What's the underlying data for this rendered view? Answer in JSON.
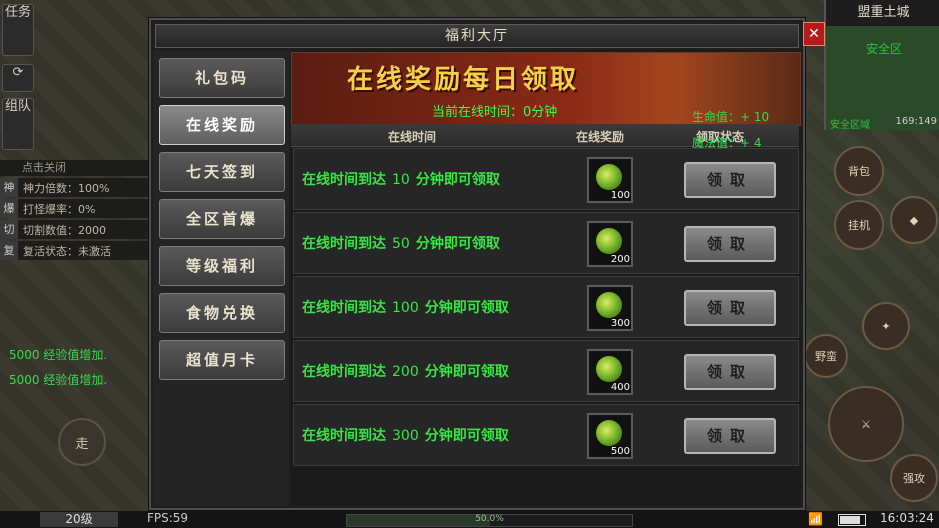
{
  "hud": {
    "left_buttons": [
      "任务",
      "组队"
    ],
    "stats_header": "点击关闭",
    "stats": [
      {
        "key": "神",
        "text": "神力倍数：100%"
      },
      {
        "key": "爆",
        "text": "打怪爆率：0%"
      },
      {
        "key": "切",
        "text": "切割数值：2000"
      },
      {
        "key": "复",
        "text": "复活状态：未激活"
      }
    ],
    "exp_messages": [
      "5000 经验值增加.",
      "5000 经验值增加."
    ],
    "walk_label": "走",
    "level": "20级",
    "fps": "FPS:59",
    "xp_percent": "50.0%",
    "clock": "16:03:24",
    "minimap_title": "盟重土城",
    "minimap_zone": "安全区",
    "minimap_safe": "安全区域",
    "minimap_coord": "169:149",
    "right_buttons": [
      "背包",
      "挂机",
      "野蛮",
      "强攻"
    ],
    "life": "生命值：+ 10",
    "mana": "魔法值：+ 4"
  },
  "dialog": {
    "title": "福利大厅",
    "close_label": "✕",
    "tabs": [
      {
        "label": "礼包码",
        "active": false
      },
      {
        "label": "在线奖励",
        "active": true
      },
      {
        "label": "七天签到",
        "active": false
      },
      {
        "label": "全区首爆",
        "active": false
      },
      {
        "label": "等级福利",
        "active": false
      },
      {
        "label": "食物兑换",
        "active": false
      },
      {
        "label": "超值月卡",
        "active": false
      }
    ],
    "banner_title": "在线奖励每日领取",
    "online_time": "当前在线时间：0分钟",
    "columns": {
      "time": "在线时间",
      "reward": "在线奖励",
      "status": "领取状态"
    },
    "rows": [
      {
        "prefix": "在线时间到达",
        "minutes": "10",
        "suffix": "分钟即可领取",
        "count": "100",
        "button": "领取"
      },
      {
        "prefix": "在线时间到达",
        "minutes": "50",
        "suffix": "分钟即可领取",
        "count": "200",
        "button": "领取"
      },
      {
        "prefix": "在线时间到达",
        "minutes": "100",
        "suffix": "分钟即可领取",
        "count": "300",
        "button": "领取"
      },
      {
        "prefix": "在线时间到达",
        "minutes": "200",
        "suffix": "分钟即可领取",
        "count": "400",
        "button": "领取"
      },
      {
        "prefix": "在线时间到达",
        "minutes": "300",
        "suffix": "分钟即可领取",
        "count": "500",
        "button": "领取"
      }
    ]
  },
  "colors": {
    "reward_text": "#33e842",
    "banner_title": "#f3d04a",
    "close": "#b31c1c"
  }
}
